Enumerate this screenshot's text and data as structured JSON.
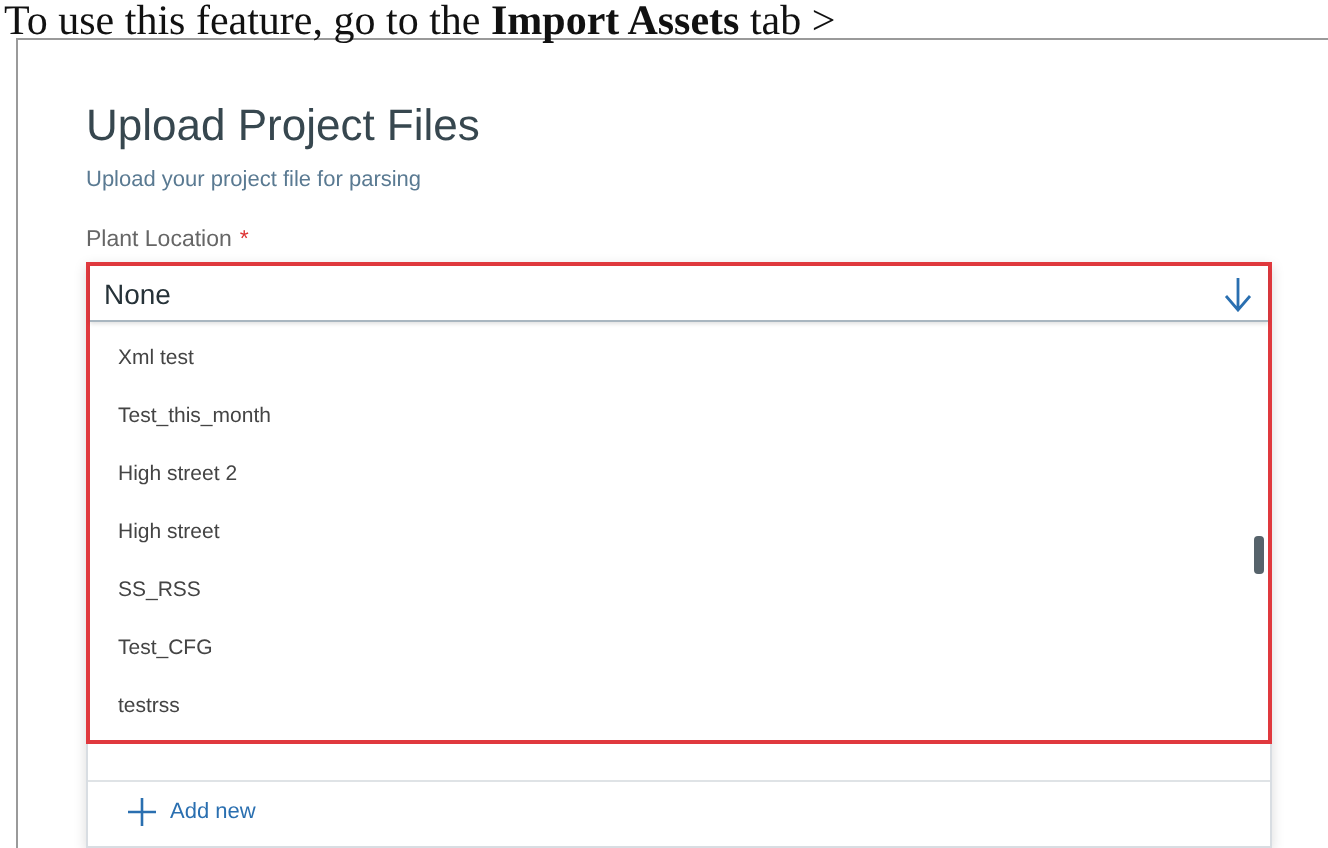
{
  "intro_text": "To use this feature, go to the **Import Assets** tab >",
  "form": {
    "title": "Upload Project Files",
    "subtitle": "Upload your project file for parsing",
    "field": {
      "label": "Plant Location",
      "required_mark": "*",
      "value": "None"
    },
    "options": [
      {
        "label": "Xml test"
      },
      {
        "label": "Test_this_month"
      },
      {
        "label": "High street 2"
      },
      {
        "label": "High street"
      },
      {
        "label": "SS_RSS"
      },
      {
        "label": "Test_CFG"
      },
      {
        "label": "testrss"
      }
    ],
    "add_new": "Add new"
  }
}
